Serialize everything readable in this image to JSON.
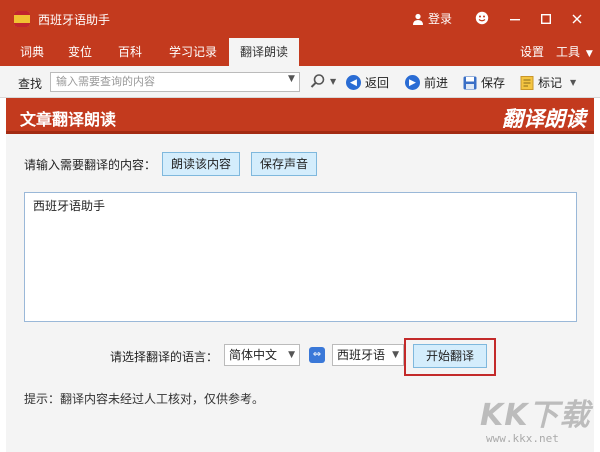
{
  "app": {
    "title": "西班牙语助手"
  },
  "titlebar": {
    "login": "登录"
  },
  "menu": {
    "tabs": [
      {
        "label": "词典"
      },
      {
        "label": "变位"
      },
      {
        "label": "百科"
      },
      {
        "label": "学习记录"
      },
      {
        "label": "翻译朗读"
      }
    ],
    "active_tab": "翻译朗读",
    "settings": "设置",
    "tools": "工具"
  },
  "toolbar": {
    "search_label": "查找",
    "search_placeholder": "输入需要查询的内容",
    "back": "返回",
    "forward": "前进",
    "save": "保存",
    "mark": "标记"
  },
  "banner": {
    "title": "文章翻译朗读",
    "logo_text": "翻译朗读"
  },
  "form": {
    "prompt": "请输入需要翻译的内容：",
    "read_button": "朗读该内容",
    "save_audio_button": "保存声音",
    "text_value": "西班牙语助手",
    "lang_label": "请选择翻译的语言：",
    "source_lang": "简体中文",
    "target_lang": "西班牙语",
    "translate_button": "开始翻译",
    "tip": "提示：翻译内容未经过人工核对，仅供参考。"
  },
  "watermark": {
    "text": "KK下载",
    "url": "www.kkx.net"
  },
  "colors": {
    "brand_red": "#c33a1e",
    "button_blue": "#d4edfc",
    "highlight_red": "#c32a2a"
  }
}
